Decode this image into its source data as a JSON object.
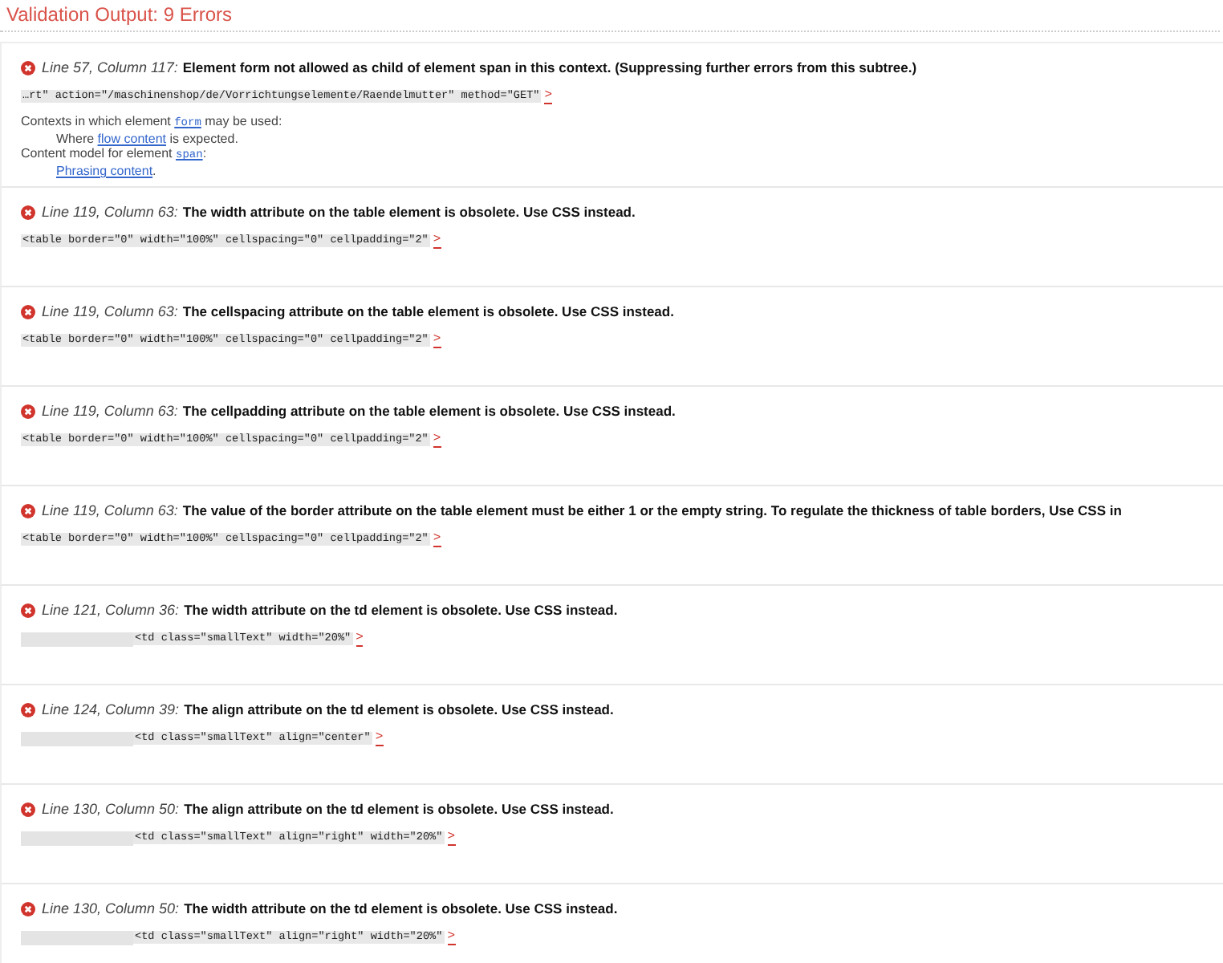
{
  "title": "Validation Output: 9 Errors",
  "errors": [
    {
      "location": "Line 57, Column 117:",
      "message": "Element form not allowed as child of element span in this context. (Suppressing further errors from this subtree.)",
      "indented": false,
      "code": "…rt\" action=\"/maschinenshop/de/Vorrichtungselemente/Raendelmutter\" method=\"GET\"",
      "marker": ">",
      "details": [
        {
          "parts": [
            {
              "text": "Contexts in which element ",
              "kind": "text"
            },
            {
              "text": "form",
              "kind": "code-link"
            },
            {
              "text": " may be used:",
              "kind": "text"
            }
          ],
          "children": [
            {
              "parts": [
                {
                  "text": "Where ",
                  "kind": "text"
                },
                {
                  "text": "flow content",
                  "kind": "link"
                },
                {
                  "text": " is expected.",
                  "kind": "text"
                }
              ]
            }
          ]
        },
        {
          "parts": [
            {
              "text": "Content model for element ",
              "kind": "text"
            },
            {
              "text": "span",
              "kind": "code-link"
            },
            {
              "text": ":",
              "kind": "text"
            }
          ],
          "children": [
            {
              "parts": [
                {
                  "text": "Phrasing content",
                  "kind": "link"
                },
                {
                  "text": ".",
                  "kind": "text"
                }
              ]
            }
          ]
        }
      ]
    },
    {
      "location": "Line 119, Column 63:",
      "message": "The width attribute on the table element is obsolete. Use CSS instead.",
      "indented": false,
      "code": "<table border=\"0\" width=\"100%\" cellspacing=\"0\" cellpadding=\"2\"",
      "marker": ">"
    },
    {
      "location": "Line 119, Column 63:",
      "message": "The cellspacing attribute on the table element is obsolete. Use CSS instead.",
      "indented": false,
      "code": "<table border=\"0\" width=\"100%\" cellspacing=\"0\" cellpadding=\"2\"",
      "marker": ">"
    },
    {
      "location": "Line 119, Column 63:",
      "message": "The cellpadding attribute on the table element is obsolete. Use CSS instead.",
      "indented": false,
      "code": "<table border=\"0\" width=\"100%\" cellspacing=\"0\" cellpadding=\"2\"",
      "marker": ">"
    },
    {
      "location": "Line 119, Column 63:",
      "message": "The value of the border attribute on the table element must be either 1 or the empty string. To regulate the thickness of table borders, Use CSS in",
      "indented": false,
      "code": "<table border=\"0\" width=\"100%\" cellspacing=\"0\" cellpadding=\"2\"",
      "marker": ">"
    },
    {
      "location": "Line 121, Column 36:",
      "message": "The width attribute on the td element is obsolete. Use CSS instead.",
      "indented": true,
      "code": "<td class=\"smallText\" width=\"20%\"",
      "marker": ">"
    },
    {
      "location": "Line 124, Column 39:",
      "message": "The align attribute on the td element is obsolete. Use CSS instead.",
      "indented": true,
      "code": "<td class=\"smallText\" align=\"center\"",
      "marker": ">"
    },
    {
      "location": "Line 130, Column 50:",
      "message": "The align attribute on the td element is obsolete. Use CSS instead.",
      "indented": true,
      "code": "<td class=\"smallText\" align=\"right\" width=\"20%\"",
      "marker": ">"
    },
    {
      "location": "Line 130, Column 50:",
      "message": "The width attribute on the td element is obsolete. Use CSS instead.",
      "indented": true,
      "code": "<td class=\"smallText\" align=\"right\" width=\"20%\"",
      "marker": ">"
    }
  ]
}
